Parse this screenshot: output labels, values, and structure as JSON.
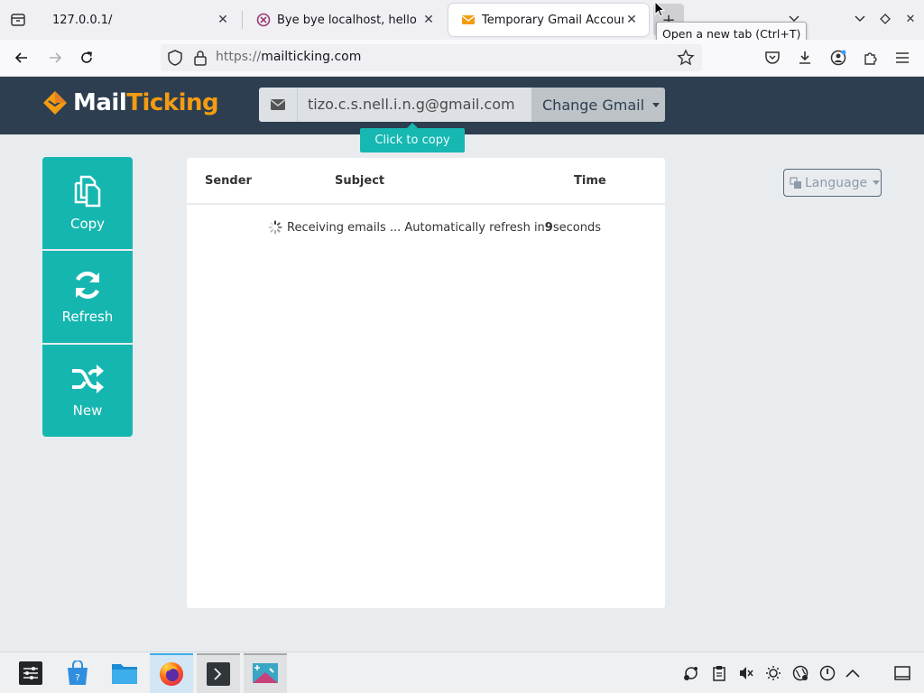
{
  "browser": {
    "tabs": [
      {
        "title": "127.0.0.1/",
        "active": false
      },
      {
        "title": "Bye bye localhost, hello wo",
        "active": false
      },
      {
        "title": "Temporary Gmail Account",
        "active": true
      }
    ],
    "new_tab_tooltip": "Open a new tab (Ctrl+T)",
    "url_scheme": "https://",
    "url_host": "mailticking.com"
  },
  "site": {
    "logo_mail": "Mail",
    "logo_ticking": "Ticking",
    "email_value": "tizo.c.s.nell.i.n.g@gmail.com",
    "change_label": "Change Gmail",
    "copy_tooltip": "Click to copy",
    "language_label": "Language"
  },
  "actions": {
    "copy_label": "Copy",
    "refresh_label": "Refresh",
    "new_label": "New"
  },
  "inbox": {
    "columns": {
      "sender": "Sender",
      "subject": "Subject",
      "time": "Time"
    },
    "status_prefix": "Receiving emails ... Automatically refresh in ",
    "countdown": "9",
    "status_suffix": " seconds"
  },
  "colors": {
    "header_bg": "#2c3e50",
    "accent_teal": "#16b6b0",
    "logo_orange": "#f39c12"
  }
}
